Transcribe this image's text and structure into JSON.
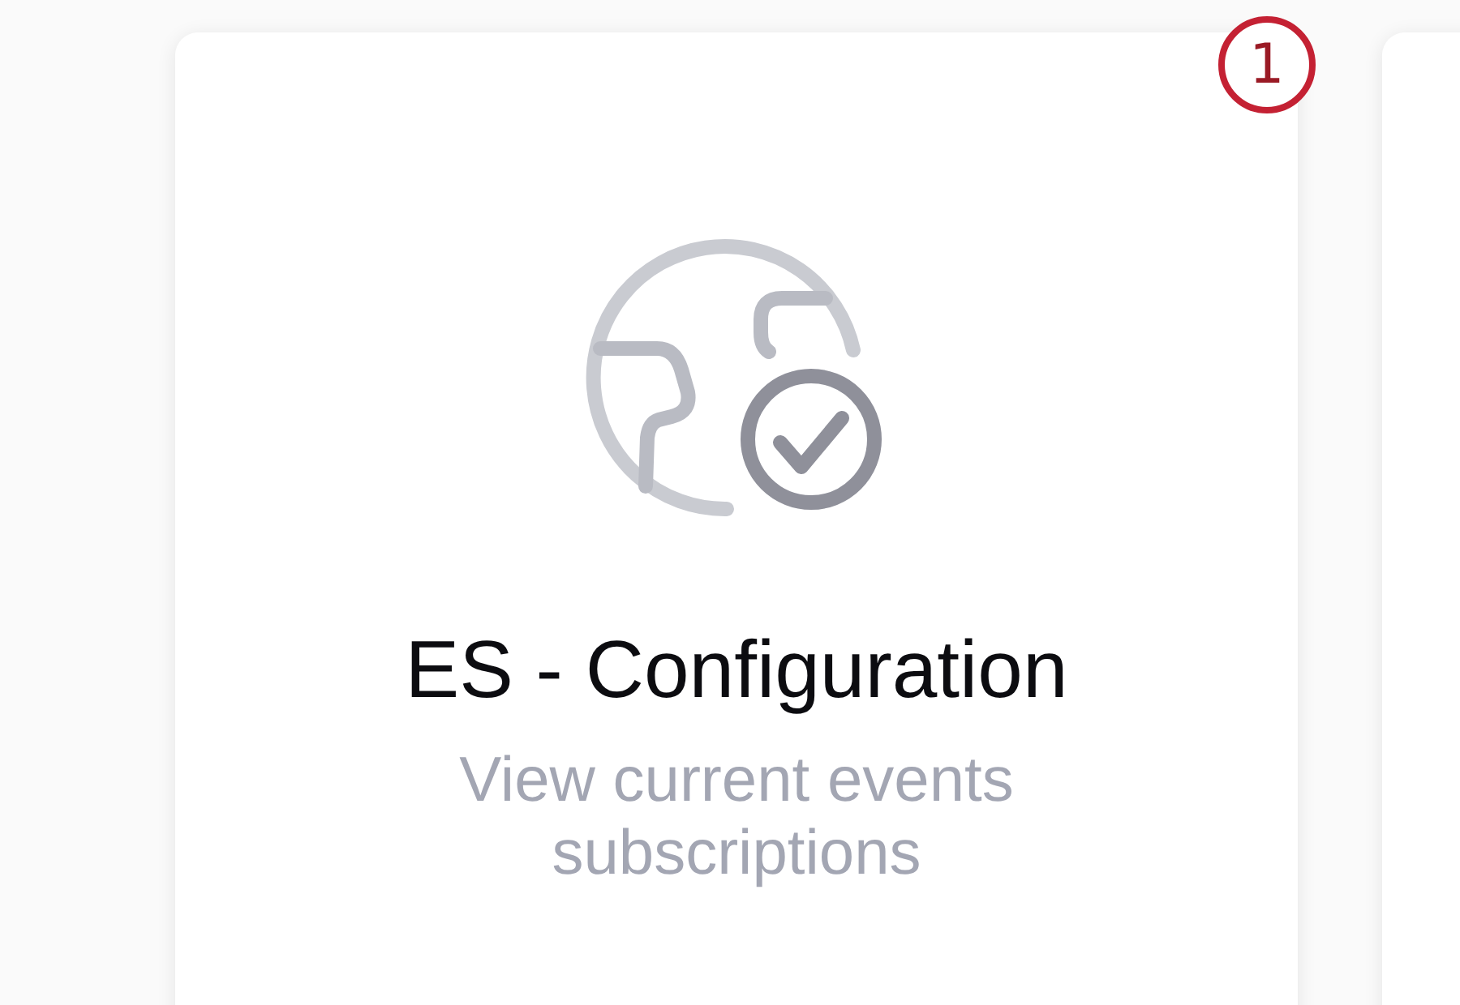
{
  "card": {
    "title": "ES - Configuration",
    "description": "View current events subscriptions"
  },
  "callout": {
    "number": "1"
  }
}
